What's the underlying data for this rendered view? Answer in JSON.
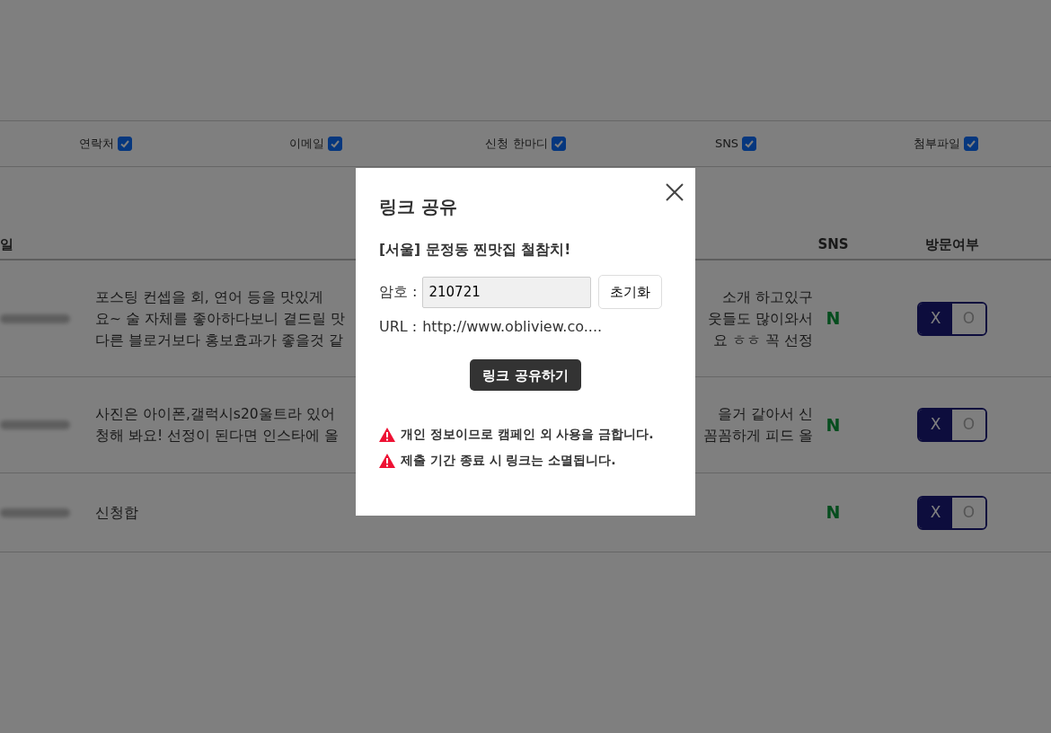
{
  "filters": [
    {
      "label": "연락처",
      "checked": true
    },
    {
      "label": "이메일",
      "checked": true
    },
    {
      "label": "신청 한마디",
      "checked": true
    },
    {
      "label": "SNS",
      "checked": true
    },
    {
      "label": "첨부파일",
      "checked": true
    }
  ],
  "table": {
    "columns": [
      "일",
      "SNS",
      "방문여부"
    ],
    "rows": [
      {
        "left_lines": [
          "포스팅 컨셉을 회, 연어 등을 맛있게",
          "요~ 술 자체를 좋아하다보니 곁드릴 맛",
          "다른 블로거보다 홍보효과가 좋을것 같"
        ],
        "right_lines": [
          "소개 하고있구",
          "웃들도 많이와서",
          "요 ㅎㅎ 꼭 선정"
        ],
        "sns": "N",
        "visit": [
          {
            "label": "X",
            "selected": true
          },
          {
            "label": "O",
            "selected": false
          }
        ]
      },
      {
        "left_lines": [
          "사진은 아이폰,갤럭시s20울트라 있어",
          "청해 봐요! 선정이 된다면 인스타에 올"
        ],
        "right_lines": [
          "을거 같아서 신",
          "꼼꼼하게 피드 올"
        ],
        "sns": "N",
        "visit": [
          {
            "label": "X",
            "selected": true
          },
          {
            "label": "O",
            "selected": false
          }
        ]
      },
      {
        "left_lines": [
          "신청합"
        ],
        "right_lines": [],
        "sns": "N",
        "visit": [
          {
            "label": "X",
            "selected": true
          },
          {
            "label": "O",
            "selected": false
          }
        ]
      }
    ]
  },
  "modal": {
    "title": "링크 공유",
    "campaign": "[서울] 문정동 찐맛집 철참치!",
    "password_label": "암호 :",
    "password_value": "210721",
    "reset_button": "초기화",
    "url_label": "URL :",
    "url_value": "http://www.obliview.co....",
    "share_button": "링크 공유하기",
    "warnings": [
      "개인 정보이므로 캠페인 외 사용을 금합니다.",
      "제출 기간 종료 시 링크는 소멸됩니다."
    ]
  }
}
